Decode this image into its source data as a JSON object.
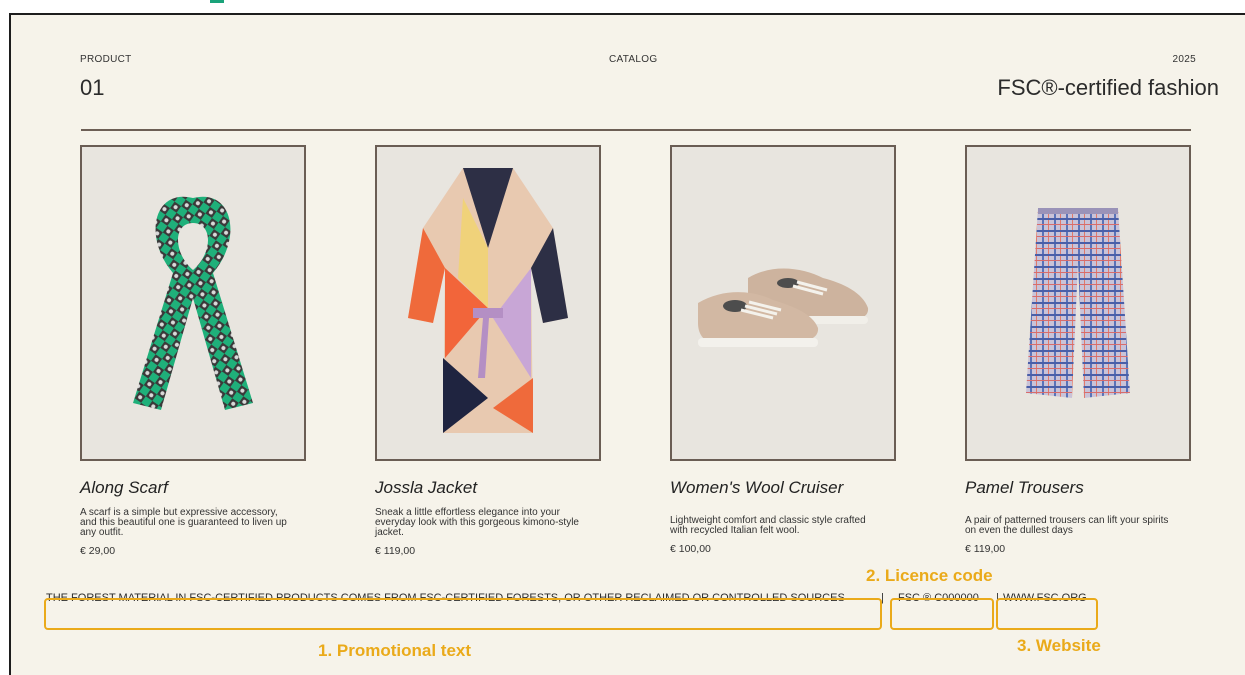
{
  "header": {
    "left_label": "PRODUCT",
    "left_number": "01",
    "center_label": "CATALOG",
    "right_year": "2025",
    "right_title": "FSC®-certified fashion"
  },
  "products": [
    {
      "name": "Along Scarf",
      "description": "A scarf is a simple but expressive accessory, and this beautiful one is guaranteed to liven up any outfit.",
      "price": "€ 29,00",
      "image": "scarf"
    },
    {
      "name": "Jossla Jacket",
      "description": "Sneak a little effortless elegance into your everyday look with this gorgeous kimono-style jacket.",
      "price": "€ 119,00",
      "image": "kimono-jacket"
    },
    {
      "name": "Women's Wool Cruiser",
      "description": "Lightweight comfort and classic style crafted with recycled Italian felt wool.",
      "price": "€ 100,00",
      "image": "wool-sneakers"
    },
    {
      "name": "Pamel Trousers",
      "description": "A pair of patterned trousers can lift your spirits on even the dullest days",
      "price": "€ 119,00",
      "image": "plaid-trousers"
    }
  ],
  "footer": {
    "promo_text": "THE FOREST MATERIAL IN FSC-CERTIFIED PRODUCTS COMES FROM FSC-CERTIFIED FORESTS, OR OTHER RECLAIMED OR CONTROLLED SOURCES",
    "separator": "|",
    "licence_code": "FSC ® C000000",
    "website": "WWW.FSC.ORG"
  },
  "annotations": {
    "promo_label": "1. Promotional text",
    "licence_label": "2. Licence code",
    "website_label": "3. Website",
    "highlight_color": "#eaaa1a"
  }
}
